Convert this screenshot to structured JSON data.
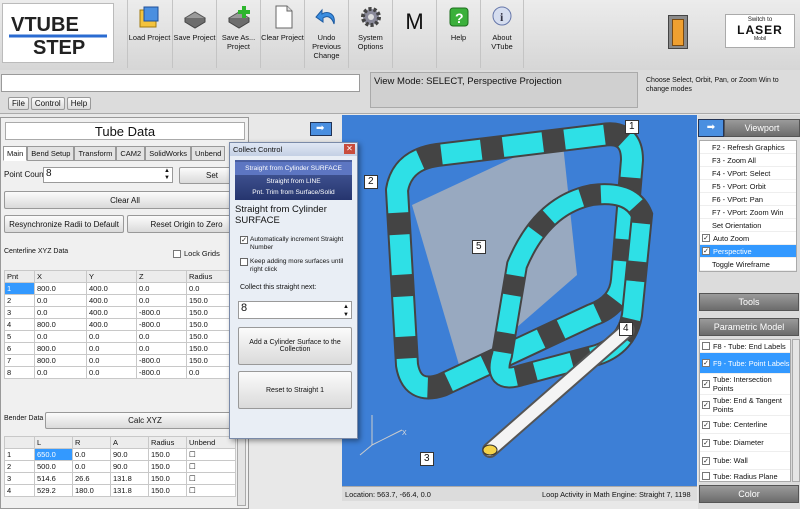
{
  "app": {
    "logo_text": "VTUBE STEP"
  },
  "toolbar": {
    "buttons": [
      {
        "label": "Load Project"
      },
      {
        "label": "Save Project"
      },
      {
        "label": "Save As... Project"
      },
      {
        "label": "Clear Project"
      },
      {
        "label": "Undo Previous Change"
      },
      {
        "label": "System Options"
      },
      {
        "label": "M"
      },
      {
        "label": "Help"
      },
      {
        "label": "About VTube"
      }
    ],
    "switch_label": "Switch to",
    "switch_brand": "LASER",
    "switch_sub": "Mobil"
  },
  "menu": [
    "File",
    "Control",
    "Help"
  ],
  "view_mode": "View Mode: SELECT, Perspective Projection",
  "view_hint": "Choose Select, Orbit, Pan, or Zoom Win to change modes",
  "tube_data": {
    "title": "Tube Data",
    "tabs": [
      "Main",
      "Bend Setup",
      "Transform",
      "CAM2",
      "SolidWorks",
      "Unbend"
    ],
    "point_count_label": "Point Count",
    "point_count": "8",
    "set_label": "Set",
    "clear_all": "Clear All",
    "resync": "Resynchronize Radii to Default",
    "reset_origin": "Reset Origin to Zero",
    "centerline_label": "Centerline XYZ Data",
    "lock_grids": "Lock Grids",
    "columns": [
      "Pnt",
      "X",
      "Y",
      "Z",
      "Radius"
    ],
    "rows": [
      [
        "1",
        "800.0",
        "400.0",
        "0.0",
        "0.0"
      ],
      [
        "2",
        "0.0",
        "400.0",
        "0.0",
        "150.0"
      ],
      [
        "3",
        "0.0",
        "400.0",
        "-800.0",
        "150.0"
      ],
      [
        "4",
        "800.0",
        "400.0",
        "-800.0",
        "150.0"
      ],
      [
        "5",
        "0.0",
        "0.0",
        "0.0",
        "150.0"
      ],
      [
        "6",
        "800.0",
        "0.0",
        "0.0",
        "150.0"
      ],
      [
        "7",
        "800.0",
        "0.0",
        "-800.0",
        "150.0"
      ],
      [
        "8",
        "0.0",
        "0.0",
        "-800.0",
        "0.0"
      ]
    ],
    "bender_label": "Bender Data",
    "calc_xyz": "Calc XYZ",
    "bender_columns": [
      "",
      "L",
      "R",
      "A",
      "Radius",
      "Unbend"
    ],
    "bender_rows": [
      [
        "1",
        "650.0",
        "0.0",
        "90.0",
        "150.0"
      ],
      [
        "2",
        "500.0",
        "0.0",
        "90.0",
        "150.0"
      ],
      [
        "3",
        "514.6",
        "26.6",
        "131.8",
        "150.0"
      ],
      [
        "4",
        "529.2",
        "180.0",
        "131.8",
        "150.0"
      ]
    ]
  },
  "collect": {
    "title": "Collect Control",
    "list": [
      "Straight from Cylinder SURFACE",
      "Straight from LINE",
      "Pnt. Trim from Surface/Solid"
    ],
    "heading": "Straight from Cylinder SURFACE",
    "auto_increment": "Automatically increment Straight Number",
    "keep_adding": "Keep adding more surfaces until right click",
    "collect_next": "Collect this straight next:",
    "straight_num": "8",
    "add_surface": "Add a Cylinder Surface to the Collection",
    "reset": "Reset to Straight 1"
  },
  "viewport": {
    "callouts": [
      "1",
      "2",
      "3",
      "4",
      "5"
    ],
    "location": "Location: 563.7, -66.4, 0.0",
    "loop": "Loop Activity in Math Engine:  Straight 7, 1198",
    "axis": "X"
  },
  "right_panel": {
    "viewport_header": "Viewport",
    "items": [
      {
        "label": "F2 - Refresh Graphics"
      },
      {
        "label": "F3 - Zoom All"
      },
      {
        "label": "F4 - VPort: Select"
      },
      {
        "label": "F5 - VPort: Orbit"
      },
      {
        "label": "F6 - VPort: Pan"
      },
      {
        "label": "F7 - VPort: Zoom Win"
      },
      {
        "label": "Set Orientation"
      },
      {
        "label": "Auto Zoom"
      },
      {
        "label": "Perspective"
      },
      {
        "label": "Toggle Wireframe"
      }
    ],
    "tools_header": "Tools",
    "param_header": "Parametric Model",
    "param_items": [
      {
        "label": "F8 - Tube: End Labels"
      },
      {
        "label": "F9 - Tube: Point Labels"
      },
      {
        "label": "Tube: Intersection Points"
      },
      {
        "label": "Tube: End & Tangent Points"
      },
      {
        "label": "Tube: Centerline"
      },
      {
        "label": "Tube: Diameter"
      },
      {
        "label": "Tube: Wall"
      },
      {
        "label": "Tube: Radius Plane"
      }
    ],
    "color_header": "Color"
  },
  "colors": {
    "accent": "#3399ff",
    "viewport_bg": "#3d7fd6",
    "tube_cyan": "#2ee0e6"
  }
}
